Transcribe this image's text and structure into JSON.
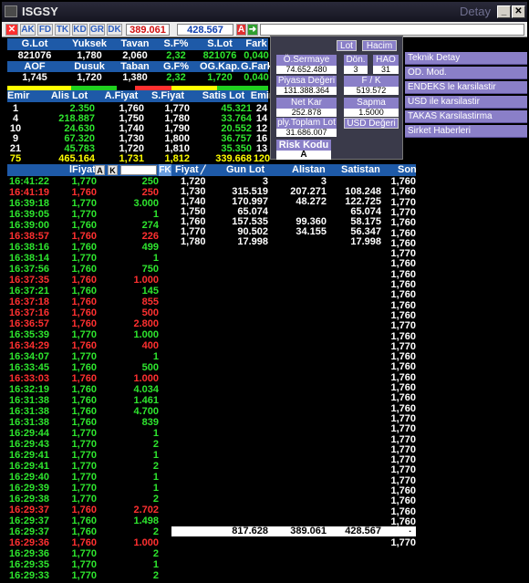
{
  "window": {
    "title": "ISGSY",
    "right_label": "Detay",
    "min": "_",
    "max": "□",
    "close": "✕"
  },
  "toolbar": {
    "tabs": [
      "AK",
      "FD",
      "TK",
      "KD",
      "GR",
      "DK"
    ],
    "value1": "389.061",
    "value2": "428.567",
    "a_label": "A"
  },
  "summary": {
    "h1": [
      "G.Lot",
      "Yuksek",
      "Tavan",
      "S.F%",
      "S.Lot",
      "Fark"
    ],
    "r1": [
      "821076",
      "1,780",
      "2,060",
      "2,32",
      "821076",
      "0,040"
    ],
    "h2": [
      "AOF",
      "Dusuk",
      "Taban",
      "G.F%",
      "OG.Kap.",
      "G.Fark"
    ],
    "r2": [
      "1,745",
      "1,720",
      "1,380",
      "2,32",
      "1,720",
      "0,040"
    ]
  },
  "depth": {
    "headers": [
      "Emir",
      "Alis Lot",
      "A.Fiyat",
      "S.Fiyat",
      "Satis Lot",
      "Emir"
    ],
    "rows": [
      [
        "1",
        "2.350",
        "1,760",
        "1,770",
        "45.321",
        "24"
      ],
      [
        "4",
        "218.887",
        "1,750",
        "1,780",
        "33.764",
        "14"
      ],
      [
        "10",
        "24.630",
        "1,740",
        "1,790",
        "20.552",
        "12"
      ],
      [
        "9",
        "67.320",
        "1,730",
        "1,800",
        "36.757",
        "16"
      ],
      [
        "21",
        "45.783",
        "1,720",
        "1,810",
        "35.350",
        "13"
      ],
      [
        "75",
        "465.164",
        "1,731",
        "1,812",
        "339.668",
        "120"
      ]
    ]
  },
  "panel": {
    "lot": "Lot",
    "hacim": "Hacim",
    "o_sermaye": "Ö.Sermaye",
    "o_sermaye_val": "74.652.480",
    "don": "Dön.",
    "don_val": "3",
    "hao": "HAO",
    "hao_val": "31",
    "piyasa": "Piyasa Değeri",
    "piyasa_val": "131.388.364",
    "fk": "F / K",
    "fk_val": "519.572",
    "netkar": "Net Kar",
    "netkar_val": "252.878",
    "sapma": "Sapma",
    "sapma_val": "1.5000",
    "ply": "ply.Toplam Lot",
    "ply_val": "31.686.007",
    "usd": "USD Değeri",
    "risk": "Risk Kodu",
    "risk_val": "A"
  },
  "menu": [
    "Teknik Detay",
    "OD. Mod.",
    "ENDEKS le karsilastir",
    "USD ile karsilastir",
    "TAKAS Karsilastirma",
    "Sirket Haberleri"
  ],
  "trades": {
    "headers": [
      "",
      "lFiyat",
      "",
      "FK"
    ],
    "ak_btn": "A",
    "k_btn": "K",
    "rows": [
      [
        "16:41:22",
        "1,770",
        "250",
        "g"
      ],
      [
        "16:41:19",
        "1,760",
        "250",
        "r"
      ],
      [
        "16:39:18",
        "1,770",
        "3.000",
        "g"
      ],
      [
        "16:39:05",
        "1,770",
        "1",
        "g"
      ],
      [
        "16:39:00",
        "1,760",
        "274",
        "g"
      ],
      [
        "16:38:57",
        "1,760",
        "226",
        "r"
      ],
      [
        "16:38:16",
        "1,760",
        "499",
        "g"
      ],
      [
        "16:38:14",
        "1,770",
        "1",
        "g"
      ],
      [
        "16:37:56",
        "1,760",
        "750",
        "g"
      ],
      [
        "16:37:35",
        "1,760",
        "1.000",
        "r"
      ],
      [
        "16:37:21",
        "1,760",
        "145",
        "g"
      ],
      [
        "16:37:18",
        "1,760",
        "855",
        "r"
      ],
      [
        "16:37:16",
        "1,760",
        "500",
        "r"
      ],
      [
        "16:36:57",
        "1,760",
        "2.800",
        "r"
      ],
      [
        "16:35:39",
        "1,770",
        "1.000",
        "g"
      ],
      [
        "16:34:29",
        "1,760",
        "400",
        "r"
      ],
      [
        "16:34:07",
        "1,770",
        "1",
        "g"
      ],
      [
        "16:33:45",
        "1,760",
        "500",
        "g"
      ],
      [
        "16:33:03",
        "1,760",
        "1.000",
        "r"
      ],
      [
        "16:32:19",
        "1,760",
        "4.034",
        "g"
      ],
      [
        "16:31:38",
        "1,760",
        "1.461",
        "g"
      ],
      [
        "16:31:38",
        "1,760",
        "4.700",
        "g"
      ],
      [
        "16:31:38",
        "1,760",
        "839",
        "g"
      ],
      [
        "16:29:44",
        "1,770",
        "1",
        "g"
      ],
      [
        "16:29:43",
        "1,770",
        "2",
        "g"
      ],
      [
        "16:29:41",
        "1,770",
        "1",
        "g"
      ],
      [
        "16:29:41",
        "1,770",
        "2",
        "g"
      ],
      [
        "16:29:40",
        "1,770",
        "1",
        "g"
      ],
      [
        "16:29:39",
        "1,770",
        "1",
        "g"
      ],
      [
        "16:29:38",
        "1,770",
        "2",
        "g"
      ],
      [
        "16:29:37",
        "1,760",
        "2.702",
        "r"
      ],
      [
        "16:29:37",
        "1,760",
        "1.498",
        "g"
      ],
      [
        "16:29:37",
        "1,760",
        "2",
        "g"
      ],
      [
        "16:29:36",
        "1,760",
        "1.000",
        "r"
      ],
      [
        "16:29:36",
        "1,770",
        "2",
        "g"
      ],
      [
        "16:29:35",
        "1,770",
        "1",
        "g"
      ],
      [
        "16:29:33",
        "1,770",
        "2",
        "g"
      ]
    ]
  },
  "volume": {
    "headers": [
      "Fiyat",
      "Gun Lot",
      "Alistan",
      "Satistan",
      "Son"
    ],
    "rows": [
      [
        "1,720",
        "3",
        "3",
        ""
      ],
      [
        "1,730",
        "315.519",
        "207.271",
        "108.248"
      ],
      [
        "1,740",
        "170.997",
        "48.272",
        "122.725"
      ],
      [
        "1,750",
        "65.074",
        "",
        "65.074"
      ],
      [
        "1,760",
        "157.535",
        "99.360",
        "58.175"
      ],
      [
        "1,770",
        "90.502",
        "34.155",
        "56.347"
      ],
      [
        "1,780",
        "17.998",
        "",
        "17.998"
      ]
    ],
    "totals": [
      "817.628",
      "389.061",
      "428.567",
      "-"
    ]
  },
  "son": [
    "1,760",
    "1,760",
    "1,770",
    "1,770",
    "1,760",
    "1,760",
    "1,760",
    "1,770",
    "1,760",
    "1,760",
    "1,760",
    "1,760",
    "1,760",
    "1,760",
    "1,770",
    "1,760",
    "1,770",
    "1,760",
    "1,760",
    "1,760",
    "1,760",
    "1,760",
    "1,760",
    "1,770",
    "1,770",
    "1,770",
    "1,770",
    "1,770",
    "1,770",
    "1,770",
    "1,760",
    "1,760",
    "1,760",
    "1,760",
    "1,770",
    "1,770"
  ]
}
